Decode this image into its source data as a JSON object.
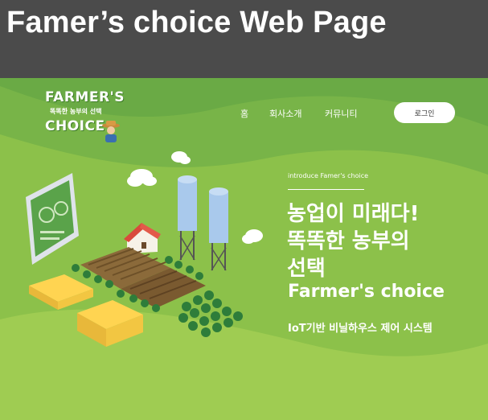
{
  "slide": {
    "title": "Famer’s choice Web Page"
  },
  "logo": {
    "line1": "FARMER'S",
    "line2": "똑똑한 농부의 선택",
    "line3": "CHOICE"
  },
  "nav": {
    "items": [
      {
        "label": "홈"
      },
      {
        "label": "회사소개"
      },
      {
        "label": "커뮤니티"
      }
    ],
    "login_label": "로그인"
  },
  "hero": {
    "intro": "introduce Famer's choice",
    "headline_line1": "농업이 미래다!",
    "headline_line2": "똑똑한 농부의",
    "headline_line3": "선택",
    "brand": "Farmer's choice",
    "subtitle": "IoT기반 비닐하우스 제어 시스템"
  },
  "colors": {
    "title_bar": "#4b4b4b",
    "hero_green": "#8cc14a",
    "text": "#ffffff"
  }
}
